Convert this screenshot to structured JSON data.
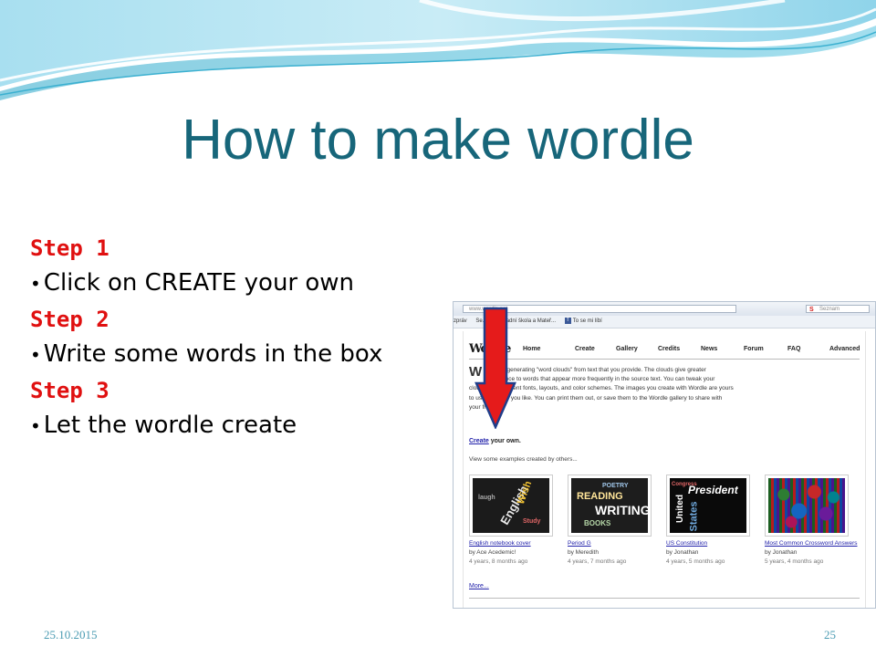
{
  "slide": {
    "title": "How to make wordle",
    "steps": [
      {
        "label": "Step 1",
        "bullet": "Click on CREATE your own"
      },
      {
        "label": "Step 2",
        "bullet": "Write some words in the box"
      },
      {
        "label": "Step 3",
        "bullet": "Let the wordle create"
      }
    ],
    "footer": {
      "date": "25.10.2015",
      "page": "25"
    }
  },
  "colors": {
    "title": "#17667a",
    "step": "#e01010",
    "arrow": "#e51b1b",
    "link": "#2222aa"
  },
  "browser": {
    "url": "www.wordle.net",
    "search_placeholder": "Seznam",
    "bookmarks": [
      "zpráv",
      "Se...",
      "Základní škola a Mateř...",
      "To se mi líbí"
    ],
    "logo": "Wordle",
    "nav": [
      "Home",
      "Create",
      "Gallery",
      "Credits",
      "News",
      "Forum",
      "FAQ",
      "Advanced"
    ],
    "intro_big": "W",
    "intro": "...toy for generating \"word clouds\" from text that you provide. The clouds give greater prominence to words that appear more frequently in the source text. You can tweak your clouds with different fonts, layouts, and color schemes. The images you create with Wordle are yours to use however you like. You can print them out, or save them to the Wordle gallery to share with your friends.",
    "create_link": "Create",
    "create_rest": " your own.",
    "view_examples": "View some examples created by others...",
    "gallery": [
      {
        "title": "English notebook cover",
        "author": "by Ace Acedemic!",
        "age": "4 years, 8 months ago",
        "words": [
          "English",
          "Wish",
          "laugh",
          "Study"
        ]
      },
      {
        "title": "Period G",
        "author": "by Meredith",
        "age": "4 years, 7 months ago",
        "words": [
          "READING",
          "WRITING",
          "POETRY",
          "BOOKS"
        ]
      },
      {
        "title": "US Constitution",
        "author": "by Jonathan",
        "age": "4 years, 5 months ago",
        "words": [
          "President",
          "United",
          "States",
          "Congress"
        ]
      },
      {
        "title": "Most Common Crossword Answers",
        "author": "by Jonathan",
        "age": "5 years, 4 months ago",
        "words": []
      }
    ],
    "more": "More..."
  }
}
